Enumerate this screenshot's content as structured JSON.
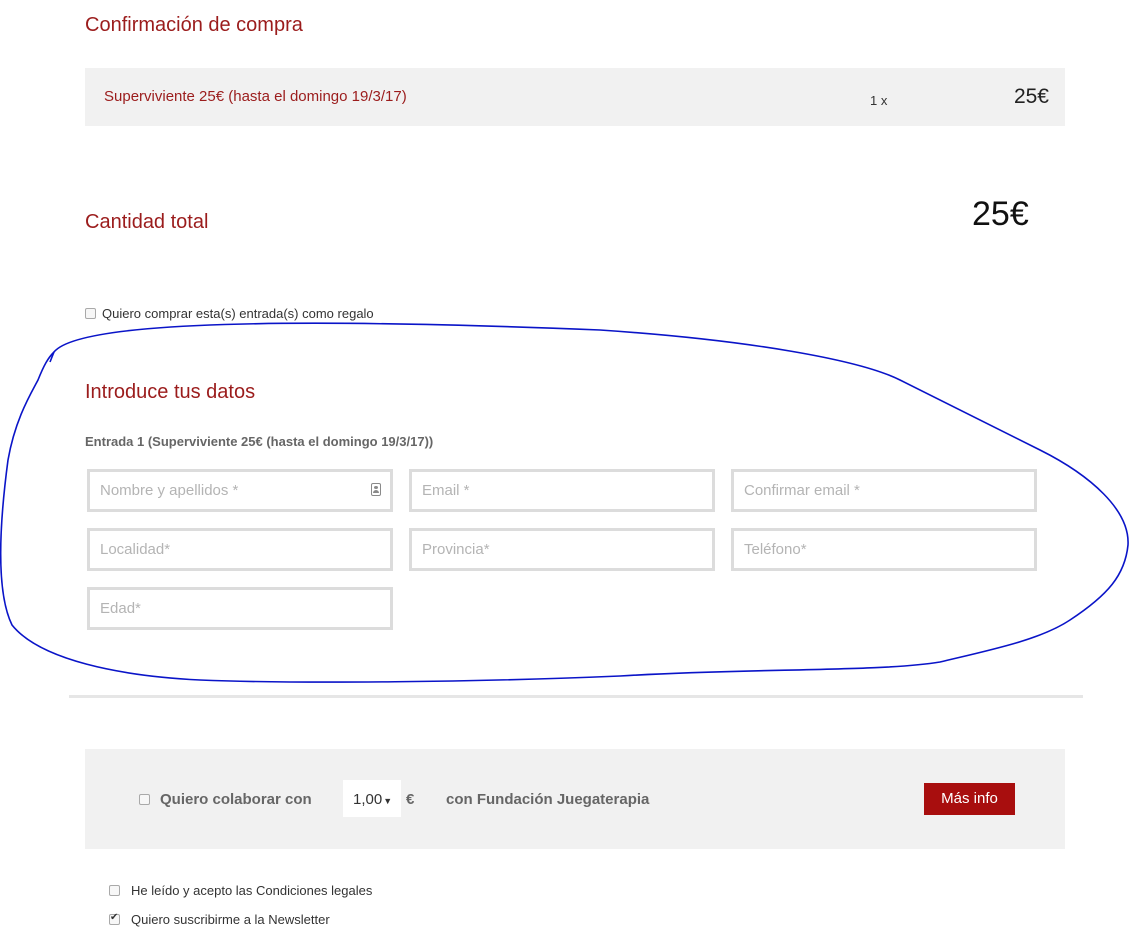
{
  "purchase": {
    "title": "Confirmación de compra",
    "item": {
      "name": "Superviviente 25€ (hasta el domingo 19/3/17)",
      "quantity": "1 x",
      "price": "25€"
    }
  },
  "total": {
    "label": "Cantidad total",
    "amount": "25€"
  },
  "gift": {
    "label": "Quiero comprar esta(s) entrada(s) como regalo",
    "checked": false
  },
  "attendee": {
    "title": "Introduce tus datos",
    "entry_title": "Entrada 1 (Superviviente 25€ (hasta el domingo 19/3/17))",
    "fields": {
      "name": "Nombre y apellidos *",
      "email": "Email *",
      "confirm_email": "Confirmar email *",
      "city": "Localidad*",
      "province": "Provincia*",
      "phone": "Teléfono*",
      "age": "Edad*"
    },
    "name_field_icon": "contact-card-icon"
  },
  "donation": {
    "checkbox_label": "Quiero colaborar con",
    "amount": "1,00",
    "currency": "€",
    "foundation": "con Fundación Juegaterapia",
    "info_button": "Más info"
  },
  "legal": {
    "terms_label": "He leído y acepto las Condiciones legales",
    "terms_checked": false,
    "newsletter_label": "Quiero suscribirme a la Newsletter",
    "newsletter_checked": true
  },
  "colors": {
    "accent": "#9b1c1c",
    "button": "#a80e0e",
    "annotation": "#0a14c8"
  }
}
